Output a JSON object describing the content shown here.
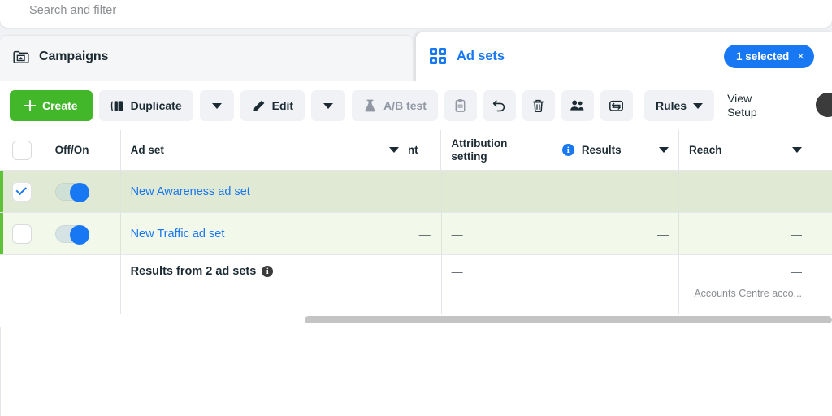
{
  "search": {
    "placeholder": "Search and filter"
  },
  "campaigns_panel": {
    "title": "Campaigns",
    "icon": "campaign-folder-icon"
  },
  "adsets_panel": {
    "title": "Ad sets",
    "icon": "grid-squares-icon",
    "selection_badge": {
      "label": "1 selected",
      "close": "×",
      "color": "#1877f2"
    }
  },
  "toolbar": {
    "create_label": "Create",
    "duplicate_label": "Duplicate",
    "edit_label": "Edit",
    "abtest_label": "A/B test",
    "rules_label": "Rules",
    "view_setup_label": "View Setup",
    "icons": {
      "duplicate": "copy-icon",
      "edit": "pencil-icon",
      "abtest": "flask-icon",
      "clipboard": "clipboard-icon",
      "undo": "undo-arrow-icon",
      "delete": "trash-icon",
      "audience": "people-icon",
      "export": "arrows-exchange-icon"
    }
  },
  "table": {
    "columns": [
      {
        "key": "check",
        "label": ""
      },
      {
        "key": "onoff",
        "label": "Off/On"
      },
      {
        "key": "adset",
        "label": "Ad set"
      },
      {
        "key": "budget",
        "label": "nt"
      },
      {
        "key": "attr",
        "label": "Attribution setting"
      },
      {
        "key": "results",
        "label": "Results"
      },
      {
        "key": "reach",
        "label": "Reach"
      }
    ],
    "rows": [
      {
        "selected": true,
        "toggle_on": true,
        "name": "New Awareness ad set",
        "budget": "—",
        "attribution": "—",
        "results": "—",
        "reach": "—"
      },
      {
        "selected": false,
        "toggle_on": true,
        "name": "New Traffic ad set",
        "budget": "—",
        "attribution": "—",
        "results": "—",
        "reach": "—"
      }
    ],
    "summary": {
      "label": "Results from 2 ad sets",
      "budget": "—",
      "attribution": "—",
      "results": "",
      "reach": "—",
      "reach_note": "Accounts Centre acco..."
    }
  }
}
